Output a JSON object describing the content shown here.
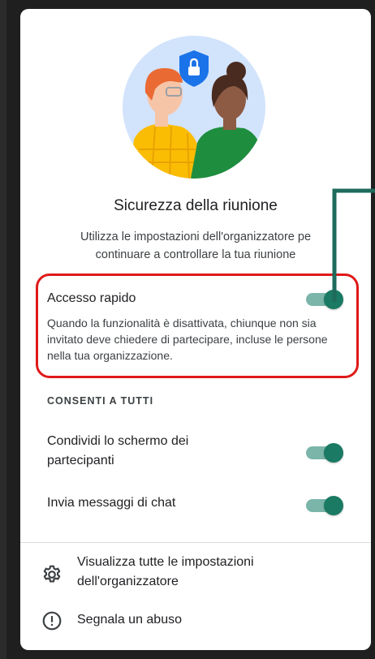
{
  "header": {
    "title": "Sicurezza della riunione",
    "subtitle": "Utilizza le impostazioni dell'organizzatore pe\ncontinuare a controllare la tua riunione"
  },
  "quick_access": {
    "label": "Accesso rapido",
    "description": "Quando la funzionalità è disattivata, chiunque non sia invitato deve chiedere di partecipare, incluse le persone nella tua organizzazione.",
    "enabled": true
  },
  "allow_all": {
    "heading": "CONSENTI A TUTTI",
    "items": [
      {
        "label": "Condividi lo schermo dei partecipanti",
        "enabled": true
      },
      {
        "label": "Invia messaggi di chat",
        "enabled": true
      }
    ]
  },
  "footer_links": [
    {
      "icon": "gear-icon",
      "label": "Visualizza tutte le impostazioni\ndell'organizzatore"
    },
    {
      "icon": "alert-icon",
      "label": "Segnala un abuso"
    }
  ],
  "colors": {
    "accent": "#1a7a63",
    "track": "#7bb5a9",
    "highlight_box": "#e01919",
    "connector_line": "#1e6b5c"
  }
}
